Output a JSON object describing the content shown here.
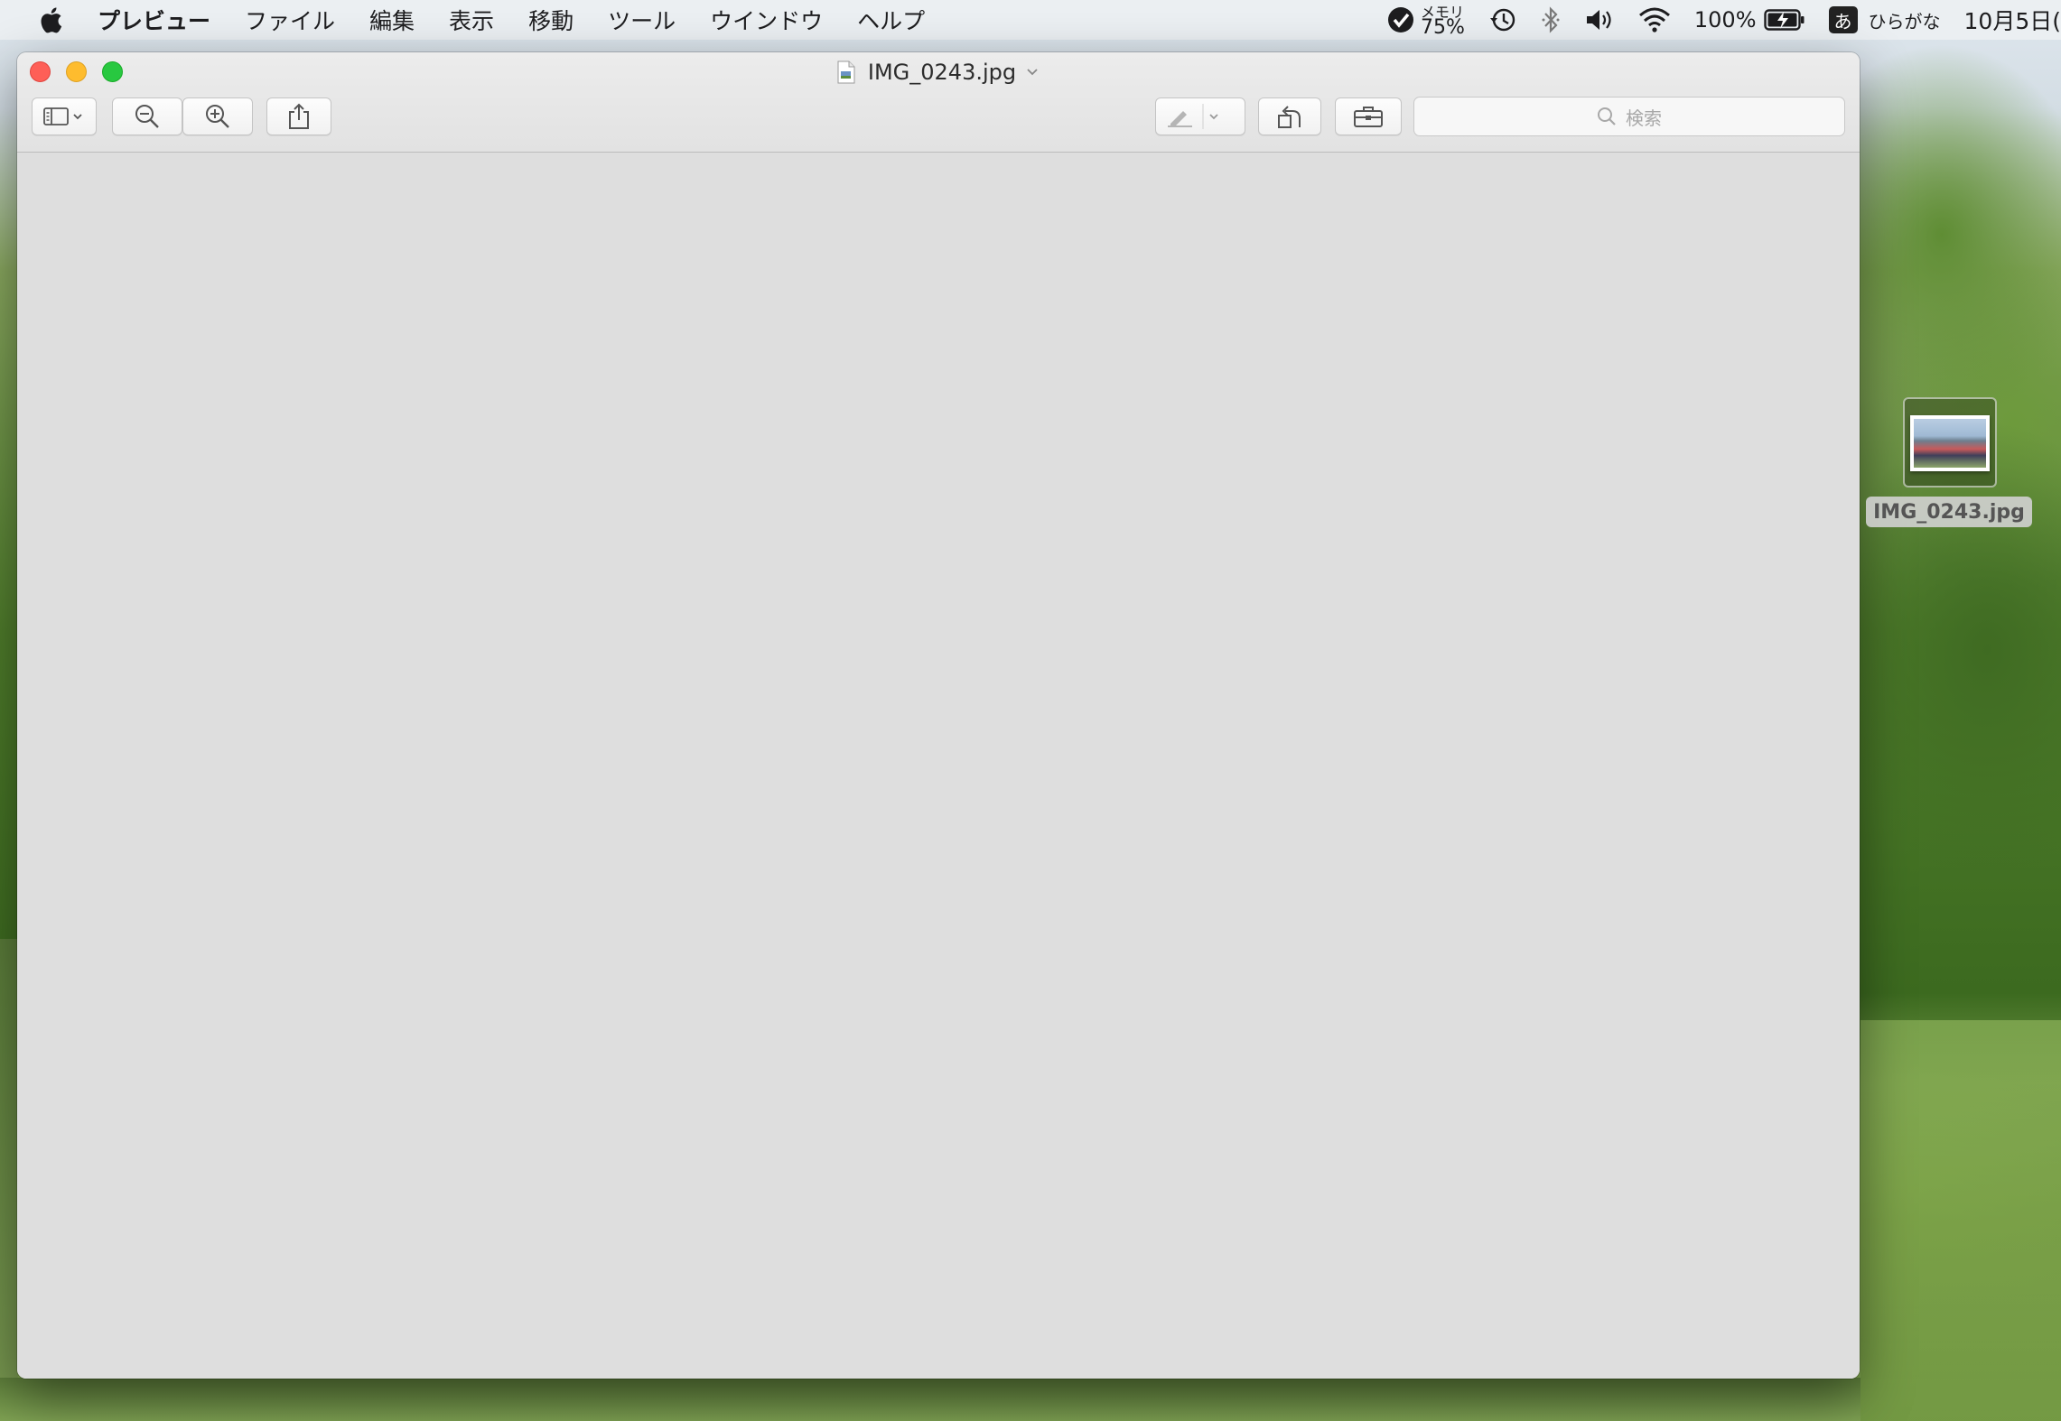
{
  "menubar": {
    "app_name": "プレビュー",
    "items": [
      "ファイル",
      "編集",
      "表示",
      "移動",
      "ツール",
      "ウインドウ",
      "ヘルプ"
    ],
    "status": {
      "memory_label": "メモリ",
      "memory_value": "75%",
      "battery_percent": "100%",
      "input_method_char": "あ",
      "input_method_label": "ひらがな",
      "clock": "10月5日("
    }
  },
  "window": {
    "title": "IMG_0243.jpg",
    "search_placeholder": "検索"
  },
  "desktop": {
    "file_label": "IMG_0243.jpg"
  },
  "colors": {
    "close": "#fe5f57",
    "minimize": "#febc2e",
    "maximize": "#28c840",
    "content_bg": "#dedede"
  }
}
